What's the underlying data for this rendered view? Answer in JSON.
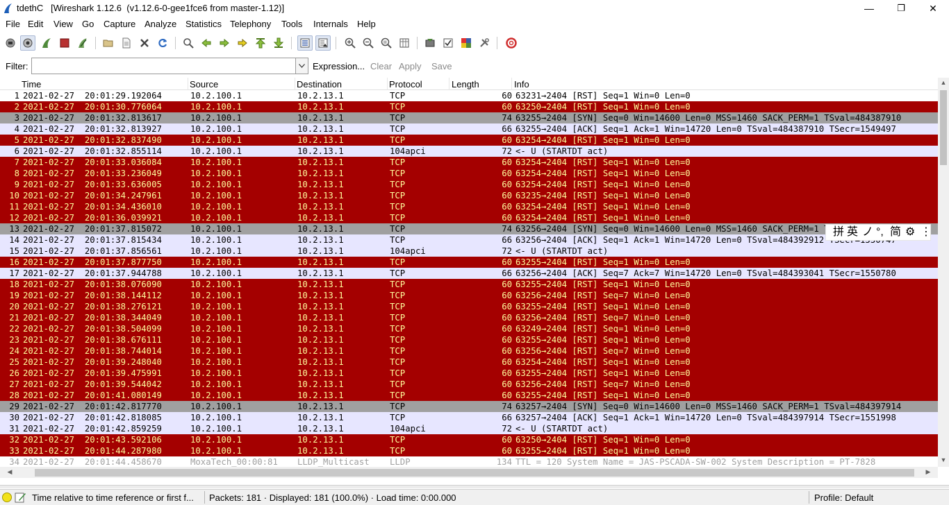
{
  "window": {
    "title": "tdethC   [Wireshark 1.12.6  (v1.12.6-0-gee1fce6 from master-1.12)]",
    "minimize": "—",
    "restore": "❐",
    "close": "✕"
  },
  "menu": [
    "File",
    "Edit",
    "View",
    "Go",
    "Capture",
    "Analyze",
    "Statistics",
    "Telephony",
    "Tools",
    "Internals",
    "Help"
  ],
  "toolbar": {
    "icons": [
      "interface-list-icon",
      "capture-options-icon",
      "start-capture-icon",
      "stop-capture-icon",
      "restart-capture-icon",
      "open-file-icon",
      "save-file-icon",
      "close-file-icon",
      "reload-icon",
      "find-packet-icon",
      "go-back-icon",
      "go-forward-icon",
      "go-to-packet-icon",
      "go-first-icon",
      "go-last-icon",
      "colorize-icon",
      "auto-scroll-icon",
      "zoom-in-icon",
      "zoom-out-icon",
      "normal-size-icon",
      "resize-columns-icon",
      "capture-filters-icon",
      "display-filters-icon",
      "coloring-rules-icon",
      "preferences-icon",
      "help-icon"
    ]
  },
  "filter": {
    "label": "Filter:",
    "value": "",
    "expression": "Expression...",
    "clear": "Clear",
    "apply": "Apply",
    "save": "Save"
  },
  "columns": {
    "time": "Time",
    "source": "Source",
    "destination": "Destination",
    "protocol": "Protocol",
    "length": "Length",
    "info": "Info"
  },
  "colors": {
    "red_bg": "#a40000",
    "red_fg": "#fffc9c",
    "lavender_bg": "#e7e6ff",
    "gray_bg": "#a0a0a0",
    "white_bg": "#ffffff",
    "dark_fg": "#000000",
    "lldp_fg": "#a0a0a0"
  },
  "packets": [
    {
      "no": "1",
      "time": "2021-02-27  20:01:29.192064",
      "src": "10.2.100.1",
      "dst": "10.2.13.1",
      "proto": "TCP",
      "len": "60",
      "info": "63231→2404 [RST] Seq=1 Win=0 Len=0",
      "style": "white"
    },
    {
      "no": "2",
      "time": "2021-02-27  20:01:30.776064",
      "src": "10.2.100.1",
      "dst": "10.2.13.1",
      "proto": "TCP",
      "len": "60",
      "info": "63250→2404 [RST] Seq=1 Win=0 Len=0",
      "style": "red"
    },
    {
      "no": "3",
      "time": "2021-02-27  20:01:32.813617",
      "src": "10.2.100.1",
      "dst": "10.2.13.1",
      "proto": "TCP",
      "len": "74",
      "info": "63255→2404 [SYN] Seq=0 Win=14600 Len=0 MSS=1460 SACK_PERM=1 TSval=484387910",
      "style": "gray"
    },
    {
      "no": "4",
      "time": "2021-02-27  20:01:32.813927",
      "src": "10.2.100.1",
      "dst": "10.2.13.1",
      "proto": "TCP",
      "len": "66",
      "info": "63255→2404 [ACK] Seq=1 Ack=1 Win=14720 Len=0 TSval=484387910 TSecr=1549497",
      "style": "lavender"
    },
    {
      "no": "5",
      "time": "2021-02-27  20:01:32.837490",
      "src": "10.2.100.1",
      "dst": "10.2.13.1",
      "proto": "TCP",
      "len": "60",
      "info": "63254→2404 [RST] Seq=1 Win=0 Len=0",
      "style": "red"
    },
    {
      "no": "6",
      "time": "2021-02-27  20:01:32.855114",
      "src": "10.2.100.1",
      "dst": "10.2.13.1",
      "proto": "104apci",
      "len": "72",
      "info": "<- U (STARTDT act)",
      "style": "lavender"
    },
    {
      "no": "7",
      "time": "2021-02-27  20:01:33.036084",
      "src": "10.2.100.1",
      "dst": "10.2.13.1",
      "proto": "TCP",
      "len": "60",
      "info": "63254→2404 [RST] Seq=1 Win=0 Len=0",
      "style": "red"
    },
    {
      "no": "8",
      "time": "2021-02-27  20:01:33.236049",
      "src": "10.2.100.1",
      "dst": "10.2.13.1",
      "proto": "TCP",
      "len": "60",
      "info": "63254→2404 [RST] Seq=1 Win=0 Len=0",
      "style": "red"
    },
    {
      "no": "9",
      "time": "2021-02-27  20:01:33.636005",
      "src": "10.2.100.1",
      "dst": "10.2.13.1",
      "proto": "TCP",
      "len": "60",
      "info": "63254→2404 [RST] Seq=1 Win=0 Len=0",
      "style": "red"
    },
    {
      "no": "10",
      "time": "2021-02-27  20:01:34.247961",
      "src": "10.2.100.1",
      "dst": "10.2.13.1",
      "proto": "TCP",
      "len": "60",
      "info": "63235→2404 [RST] Seq=1 Win=0 Len=0",
      "style": "red"
    },
    {
      "no": "11",
      "time": "2021-02-27  20:01:34.436010",
      "src": "10.2.100.1",
      "dst": "10.2.13.1",
      "proto": "TCP",
      "len": "60",
      "info": "63254→2404 [RST] Seq=1 Win=0 Len=0",
      "style": "red"
    },
    {
      "no": "12",
      "time": "2021-02-27  20:01:36.039921",
      "src": "10.2.100.1",
      "dst": "10.2.13.1",
      "proto": "TCP",
      "len": "60",
      "info": "63254→2404 [RST] Seq=1 Win=0 Len=0",
      "style": "red"
    },
    {
      "no": "13",
      "time": "2021-02-27  20:01:37.815072",
      "src": "10.2.100.1",
      "dst": "10.2.13.1",
      "proto": "TCP",
      "len": "74",
      "info": "63256→2404 [SYN] Seq=0 Win=14600 Len=0 MSS=1460 SACK_PERM=1 TSval=484392912",
      "style": "gray"
    },
    {
      "no": "14",
      "time": "2021-02-27  20:01:37.815434",
      "src": "10.2.100.1",
      "dst": "10.2.13.1",
      "proto": "TCP",
      "len": "66",
      "info": "63256→2404 [ACK] Seq=1 Ack=1 Win=14720 Len=0 TSval=484392912 TSecr=1550747",
      "style": "lavender"
    },
    {
      "no": "15",
      "time": "2021-02-27  20:01:37.856561",
      "src": "10.2.100.1",
      "dst": "10.2.13.1",
      "proto": "104apci",
      "len": "72",
      "info": "<- U (STARTDT act)",
      "style": "lavender"
    },
    {
      "no": "16",
      "time": "2021-02-27  20:01:37.877750",
      "src": "10.2.100.1",
      "dst": "10.2.13.1",
      "proto": "TCP",
      "len": "60",
      "info": "63255→2404 [RST] Seq=1 Win=0 Len=0",
      "style": "red"
    },
    {
      "no": "17",
      "time": "2021-02-27  20:01:37.944788",
      "src": "10.2.100.1",
      "dst": "10.2.13.1",
      "proto": "TCP",
      "len": "66",
      "info": "63256→2404 [ACK] Seq=7 Ack=7 Win=14720 Len=0 TSval=484393041 TSecr=1550780",
      "style": "lavender"
    },
    {
      "no": "18",
      "time": "2021-02-27  20:01:38.076090",
      "src": "10.2.100.1",
      "dst": "10.2.13.1",
      "proto": "TCP",
      "len": "60",
      "info": "63255→2404 [RST] Seq=1 Win=0 Len=0",
      "style": "red"
    },
    {
      "no": "19",
      "time": "2021-02-27  20:01:38.144112",
      "src": "10.2.100.1",
      "dst": "10.2.13.1",
      "proto": "TCP",
      "len": "60",
      "info": "63256→2404 [RST] Seq=7 Win=0 Len=0",
      "style": "red"
    },
    {
      "no": "20",
      "time": "2021-02-27  20:01:38.276121",
      "src": "10.2.100.1",
      "dst": "10.2.13.1",
      "proto": "TCP",
      "len": "60",
      "info": "63255→2404 [RST] Seq=1 Win=0 Len=0",
      "style": "red"
    },
    {
      "no": "21",
      "time": "2021-02-27  20:01:38.344049",
      "src": "10.2.100.1",
      "dst": "10.2.13.1",
      "proto": "TCP",
      "len": "60",
      "info": "63256→2404 [RST] Seq=7 Win=0 Len=0",
      "style": "red"
    },
    {
      "no": "22",
      "time": "2021-02-27  20:01:38.504099",
      "src": "10.2.100.1",
      "dst": "10.2.13.1",
      "proto": "TCP",
      "len": "60",
      "info": "63249→2404 [RST] Seq=1 Win=0 Len=0",
      "style": "red"
    },
    {
      "no": "23",
      "time": "2021-02-27  20:01:38.676111",
      "src": "10.2.100.1",
      "dst": "10.2.13.1",
      "proto": "TCP",
      "len": "60",
      "info": "63255→2404 [RST] Seq=1 Win=0 Len=0",
      "style": "red"
    },
    {
      "no": "24",
      "time": "2021-02-27  20:01:38.744014",
      "src": "10.2.100.1",
      "dst": "10.2.13.1",
      "proto": "TCP",
      "len": "60",
      "info": "63256→2404 [RST] Seq=7 Win=0 Len=0",
      "style": "red"
    },
    {
      "no": "25",
      "time": "2021-02-27  20:01:39.248040",
      "src": "10.2.100.1",
      "dst": "10.2.13.1",
      "proto": "TCP",
      "len": "60",
      "info": "63254→2404 [RST] Seq=1 Win=0 Len=0",
      "style": "red"
    },
    {
      "no": "26",
      "time": "2021-02-27  20:01:39.475991",
      "src": "10.2.100.1",
      "dst": "10.2.13.1",
      "proto": "TCP",
      "len": "60",
      "info": "63255→2404 [RST] Seq=1 Win=0 Len=0",
      "style": "red"
    },
    {
      "no": "27",
      "time": "2021-02-27  20:01:39.544042",
      "src": "10.2.100.1",
      "dst": "10.2.13.1",
      "proto": "TCP",
      "len": "60",
      "info": "63256→2404 [RST] Seq=7 Win=0 Len=0",
      "style": "red"
    },
    {
      "no": "28",
      "time": "2021-02-27  20:01:41.080149",
      "src": "10.2.100.1",
      "dst": "10.2.13.1",
      "proto": "TCP",
      "len": "60",
      "info": "63255→2404 [RST] Seq=1 Win=0 Len=0",
      "style": "red"
    },
    {
      "no": "29",
      "time": "2021-02-27  20:01:42.817770",
      "src": "10.2.100.1",
      "dst": "10.2.13.1",
      "proto": "TCP",
      "len": "74",
      "info": "63257→2404 [SYN] Seq=0 Win=14600 Len=0 MSS=1460 SACK_PERM=1 TSval=484397914",
      "style": "gray"
    },
    {
      "no": "30",
      "time": "2021-02-27  20:01:42.818085",
      "src": "10.2.100.1",
      "dst": "10.2.13.1",
      "proto": "TCP",
      "len": "66",
      "info": "63257→2404 [ACK] Seq=1 Ack=1 Win=14720 Len=0 TSval=484397914 TSecr=1551998",
      "style": "lavender"
    },
    {
      "no": "31",
      "time": "2021-02-27  20:01:42.859259",
      "src": "10.2.100.1",
      "dst": "10.2.13.1",
      "proto": "104apci",
      "len": "72",
      "info": "<- U (STARTDT act)",
      "style": "lavender"
    },
    {
      "no": "32",
      "time": "2021-02-27  20:01:43.592106",
      "src": "10.2.100.1",
      "dst": "10.2.13.1",
      "proto": "TCP",
      "len": "60",
      "info": "63250→2404 [RST] Seq=1 Win=0 Len=0",
      "style": "red"
    },
    {
      "no": "33",
      "time": "2021-02-27  20:01:44.287980",
      "src": "10.2.100.1",
      "dst": "10.2.13.1",
      "proto": "TCP",
      "len": "60",
      "info": "63255→2404 [RST] Seq=1 Win=0 Len=0",
      "style": "red"
    },
    {
      "no": "34",
      "time": "2021-02-27  20:01:44.458670",
      "src": "MoxaTech_00:00:81",
      "dst": "LLDP_Multicast",
      "proto": "LLDP",
      "len": "134",
      "info": "TTL = 120 System Name = JAS-PSCADA-SW-002 System Description = PT-7828",
      "style": "lldp"
    }
  ],
  "ime": {
    "items": [
      "拼",
      "英",
      "ノ",
      "°,",
      "简",
      "⚙",
      "⋮"
    ]
  },
  "status": {
    "hint": "Time relative to time reference or first f...",
    "packets": "Packets: 181 · Displayed: 181 (100.0%) · Load time: 0:00.000",
    "profile": "Profile: Default"
  }
}
